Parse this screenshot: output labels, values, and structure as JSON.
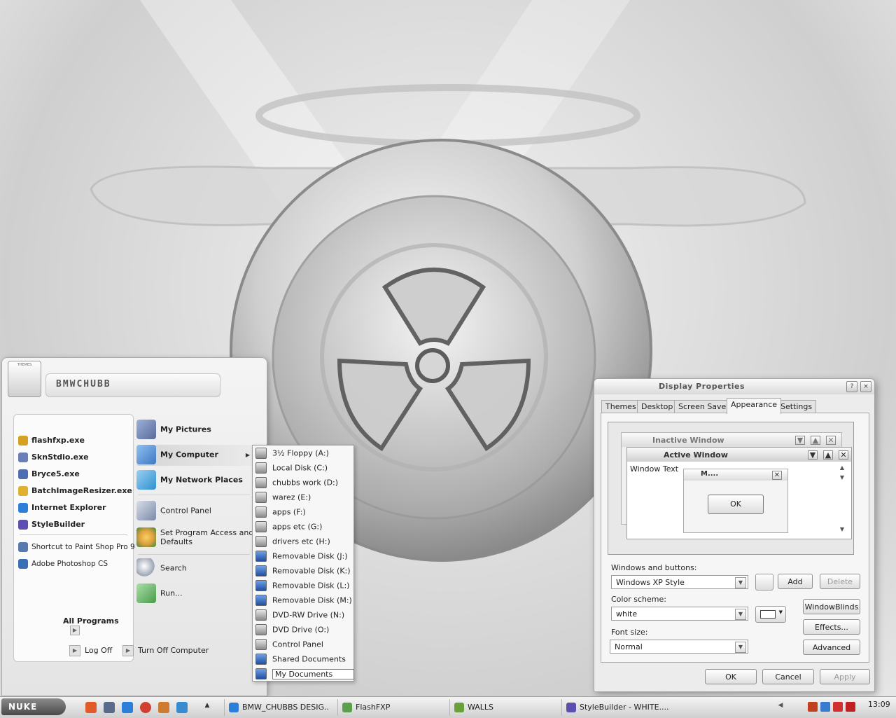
{
  "start_menu": {
    "user_badge": "THEMES",
    "user_name": "BMWCHUBB",
    "pinned": [
      {
        "label": "flashfxp.exe",
        "icon": "flashfxp-icon",
        "color": "#d8a020"
      },
      {
        "label": "SknStdio.exe",
        "icon": "skinstudio-icon",
        "color": "#6a7fb8"
      },
      {
        "label": "Bryce5.exe",
        "icon": "bryce-icon",
        "color": "#4d6eb0"
      },
      {
        "label": "BatchImageResizer.exe",
        "icon": "batch-resizer-icon",
        "color": "#e0b030"
      },
      {
        "label": "Internet Explorer",
        "icon": "internet-explorer-icon",
        "color": "#2b7fd8"
      },
      {
        "label": "StyleBuilder",
        "icon": "stylebuilder-icon",
        "color": "#5b4fb0"
      }
    ],
    "recent": [
      {
        "label": "Shortcut to Paint Shop Pro 9",
        "icon": "paint-shop-pro-icon",
        "color": "#5878b0"
      },
      {
        "label": "Adobe Photoshop CS",
        "icon": "photoshop-icon",
        "color": "#3b6fb5"
      }
    ],
    "all_programs": "All Programs",
    "places": [
      {
        "label": "My Pictures",
        "icon": "my-pictures-icon",
        "color": "#5a6a9a"
      },
      {
        "label": "My Computer",
        "icon": "my-computer-icon",
        "color": "#3f78c2"
      },
      {
        "label": "My Network Places",
        "icon": "network-places-icon",
        "color": "#2f8fd0"
      },
      {
        "label": "Control Panel",
        "icon": "control-panel-icon",
        "color": "#7a8aa8"
      },
      {
        "label": "Set Program Access and",
        "label2": "Defaults",
        "icon": "program-access-icon",
        "color": "#e0a040"
      },
      {
        "label": "Search",
        "icon": "search-icon",
        "color": "#9aa4b4"
      },
      {
        "label": "Run...",
        "icon": "run-icon",
        "color": "#4a9a4a"
      }
    ],
    "log_off": "Log Off",
    "turn_off": "Turn Off Computer"
  },
  "drive_menu": [
    {
      "label": "3½ Floppy (A:)",
      "icon": "floppy-icon"
    },
    {
      "label": "Local Disk (C:)",
      "icon": "hard-disk-icon"
    },
    {
      "label": "chubbs work (D:)",
      "icon": "hard-disk-icon"
    },
    {
      "label": "warez (E:)",
      "icon": "hard-disk-icon"
    },
    {
      "label": "apps (F:)",
      "icon": "hard-disk-icon"
    },
    {
      "label": "apps etc (G:)",
      "icon": "hard-disk-icon"
    },
    {
      "label": "drivers etc (H:)",
      "icon": "hard-disk-icon"
    },
    {
      "label": "Removable Disk (J:)",
      "icon": "removable-disk-icon"
    },
    {
      "label": "Removable Disk (K:)",
      "icon": "removable-disk-icon"
    },
    {
      "label": "Removable Disk (L:)",
      "icon": "removable-disk-icon"
    },
    {
      "label": "Removable Disk (M:)",
      "icon": "removable-disk-icon"
    },
    {
      "label": "DVD-RW Drive (N:)",
      "icon": "dvd-drive-icon"
    },
    {
      "label": "DVD Drive (O:)",
      "icon": "dvd-drive-icon"
    },
    {
      "label": "Control Panel",
      "icon": "control-panel-icon"
    },
    {
      "label": "Shared Documents",
      "icon": "shared-documents-icon"
    },
    {
      "label": "My Documents",
      "icon": "my-documents-icon"
    }
  ],
  "dialog": {
    "title": "Display Properties",
    "help": "?",
    "close": "×",
    "tabs": [
      "Themes",
      "Desktop",
      "Screen Saver",
      "Appearance",
      "Settings"
    ],
    "active_tab": "Appearance",
    "preview": {
      "inactive_title": "Inactive Window",
      "active_title": "Active Window",
      "window_text": "Window Text",
      "message_title": "M....",
      "message_ok": "OK"
    },
    "windows_buttons_label": "Windows and buttons:",
    "windows_buttons_value": "Windows XP Style",
    "add": "Add",
    "delete": "Delete",
    "color_scheme_label": "Color scheme:",
    "color_scheme_value": "white",
    "windowblinds": "WindowBlinds",
    "effects": "Effects...",
    "font_size_label": "Font size:",
    "font_size_value": "Normal",
    "advanced": "Advanced",
    "ok": "OK",
    "cancel": "Cancel",
    "apply": "Apply"
  },
  "taskbar": {
    "start_label": "NUKE",
    "quick_launch": [
      {
        "icon": "mail-icon",
        "color": "#e05a2a"
      },
      {
        "icon": "camera-icon",
        "color": "#5a6a8a"
      },
      {
        "icon": "internet-explorer-icon",
        "color": "#2b7fd8"
      },
      {
        "icon": "media-player-icon",
        "color": "#d04030"
      },
      {
        "icon": "paint-icon",
        "color": "#d07a30"
      },
      {
        "icon": "folder-icon",
        "color": "#3a8ad0"
      }
    ],
    "tasks": [
      {
        "label": "BMW_CHUBBS DESIG...",
        "icon": "internet-explorer-icon",
        "color": "#2b7fd8"
      },
      {
        "label": "FlashFXP",
        "icon": "flashfxp-icon",
        "color": "#5aa04a"
      },
      {
        "label": "WALLS",
        "icon": "folder-icon",
        "color": "#6aa03a"
      },
      {
        "label": "StyleBuilder - WHITE....",
        "icon": "stylebuilder-icon",
        "color": "#5b4fb0"
      }
    ],
    "tray": [
      {
        "icon": "tray-expand-icon",
        "color": "#555555"
      },
      {
        "icon": "tray-app-icon",
        "color": "#c04020"
      },
      {
        "icon": "tray-network-icon",
        "color": "#3a7ad0"
      },
      {
        "icon": "tray-mail-icon",
        "color": "#d03030"
      },
      {
        "icon": "tray-gmail-icon",
        "color": "#c02020"
      }
    ],
    "clock": "13:09"
  }
}
